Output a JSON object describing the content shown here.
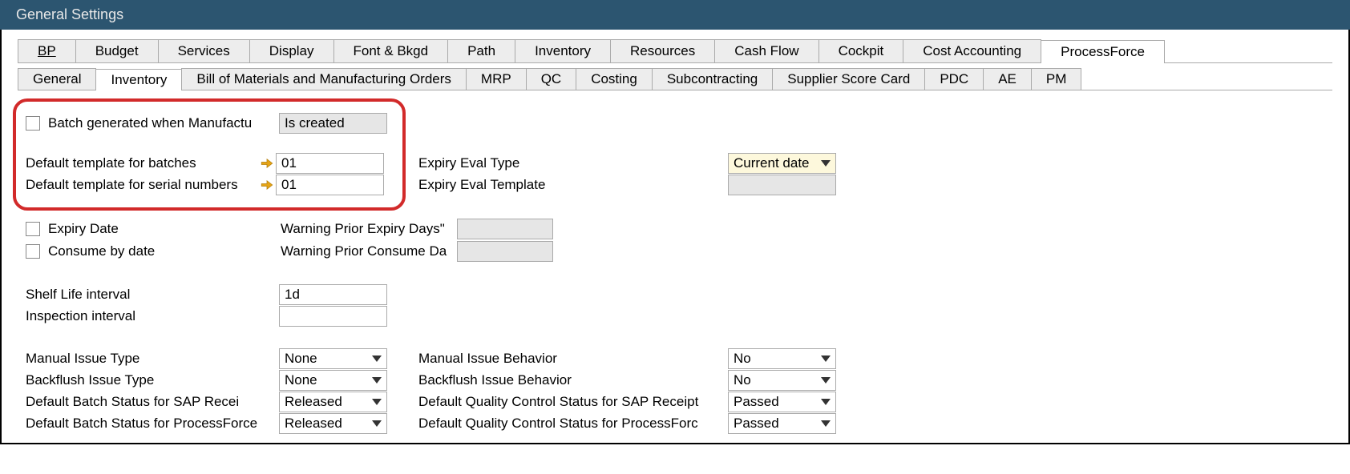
{
  "window": {
    "title": "General Settings"
  },
  "tabs": {
    "bp": "BP",
    "budget": "Budget",
    "services": "Services",
    "display": "Display",
    "font_bkgd": "Font & Bkgd",
    "path": "Path",
    "inventory": "Inventory",
    "resources": "Resources",
    "cash_flow": "Cash Flow",
    "cockpit": "Cockpit",
    "cost_accounting": "Cost Accounting",
    "processforce": "ProcessForce"
  },
  "subtabs": {
    "general": "General",
    "inventory": "Inventory",
    "bom_mo": "Bill of Materials and Manufacturing Orders",
    "mrp": "MRP",
    "qc": "QC",
    "costing": "Costing",
    "subcontracting": "Subcontracting",
    "supplier_score_card": "Supplier Score Card",
    "pdc": "PDC",
    "ae": "AE",
    "pm": "PM"
  },
  "fields": {
    "batch_gen_label": "Batch generated when Manufactu",
    "batch_gen_value": "Is created",
    "default_template_batches_label": "Default template for batches",
    "default_template_batches_value": "01",
    "default_template_serials_label": "Default template for serial numbers",
    "default_template_serials_value": "01",
    "expiry_eval_type_label": "Expiry Eval Type",
    "expiry_eval_type_value": "Current date",
    "expiry_eval_template_label": "Expiry Eval Template",
    "expiry_date_label": "Expiry Date",
    "warning_expiry_label": "Warning Prior Expiry Days\"",
    "consume_by_date_label": "Consume by date",
    "warning_consume_label": "Warning Prior Consume Da",
    "shelf_life_label": "Shelf Life interval",
    "shelf_life_value": "1d",
    "inspection_interval_label": "Inspection interval",
    "manual_issue_type_label": "Manual Issue Type",
    "manual_issue_type_value": "None",
    "backflush_issue_type_label": "Backflush Issue Type",
    "backflush_issue_type_value": "None",
    "default_batch_status_sap_label": "Default Batch Status for SAP Recei",
    "default_batch_status_sap_value": "Released",
    "default_batch_status_pf_label": "Default Batch Status for ProcessForce",
    "default_batch_status_pf_value": "Released",
    "manual_issue_behavior_label": "Manual Issue Behavior",
    "manual_issue_behavior_value": "No",
    "backflush_issue_behavior_label": "Backflush Issue Behavior",
    "backflush_issue_behavior_value": "No",
    "default_qc_status_sap_label": "Default Quality Control Status for SAP Receipt",
    "default_qc_status_sap_value": "Passed",
    "default_qc_status_pf_label": "Default Quality Control Status for ProcessForc",
    "default_qc_status_pf_value": "Passed"
  }
}
